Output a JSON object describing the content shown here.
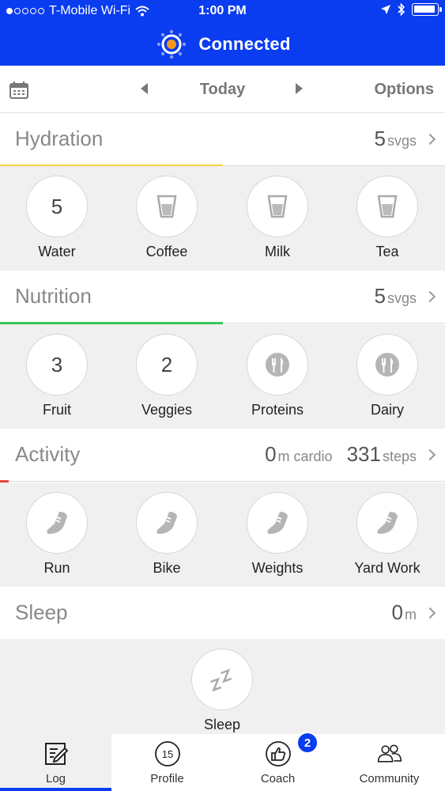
{
  "status_bar": {
    "carrier": "T-Mobile Wi-Fi",
    "time": "1:00 PM"
  },
  "header": {
    "connection_status": "Connected"
  },
  "date_nav": {
    "current": "Today",
    "options_label": "Options"
  },
  "hydration": {
    "title": "Hydration",
    "value": "5",
    "unit": "svgs",
    "progress": 0.5,
    "color": "#f0d24a",
    "items": [
      {
        "label": "Water",
        "count": "5",
        "icon": "water-count"
      },
      {
        "label": "Coffee",
        "count": "",
        "icon": "cup-icon"
      },
      {
        "label": "Milk",
        "count": "",
        "icon": "cup-icon"
      },
      {
        "label": "Tea",
        "count": "",
        "icon": "cup-icon"
      }
    ]
  },
  "nutrition": {
    "title": "Nutrition",
    "value": "5",
    "unit": "svgs",
    "progress": 0.5,
    "color": "#3cc45a",
    "items": [
      {
        "label": "Fruit",
        "count": "3",
        "icon": "fruit-count"
      },
      {
        "label": "Veggies",
        "count": "2",
        "icon": "veggies-count"
      },
      {
        "label": "Proteins",
        "count": "",
        "icon": "plate-utensils-icon"
      },
      {
        "label": "Dairy",
        "count": "",
        "icon": "plate-utensils-icon"
      }
    ]
  },
  "activity": {
    "title": "Activity",
    "cardio_value": "0",
    "cardio_unit": "m cardio",
    "steps_value": "331",
    "steps_unit": "steps",
    "progress": 0.02,
    "color": "#e8453c",
    "items": [
      {
        "label": "Run",
        "icon": "shoe-icon"
      },
      {
        "label": "Bike",
        "icon": "shoe-icon"
      },
      {
        "label": "Weights",
        "icon": "shoe-icon"
      },
      {
        "label": "Yard Work",
        "icon": "shoe-icon"
      }
    ]
  },
  "sleep": {
    "title": "Sleep",
    "value": "0",
    "unit": "m",
    "item_label": "Sleep",
    "icon": "zzz-icon"
  },
  "tabbar": {
    "log": "Log",
    "profile": "Profile",
    "profile_icon_number": "15",
    "coach": "Coach",
    "coach_badge": "2",
    "community": "Community"
  },
  "colors": {
    "brand_blue": "#0a3cf0",
    "connected_dot": "#f39a1e"
  }
}
